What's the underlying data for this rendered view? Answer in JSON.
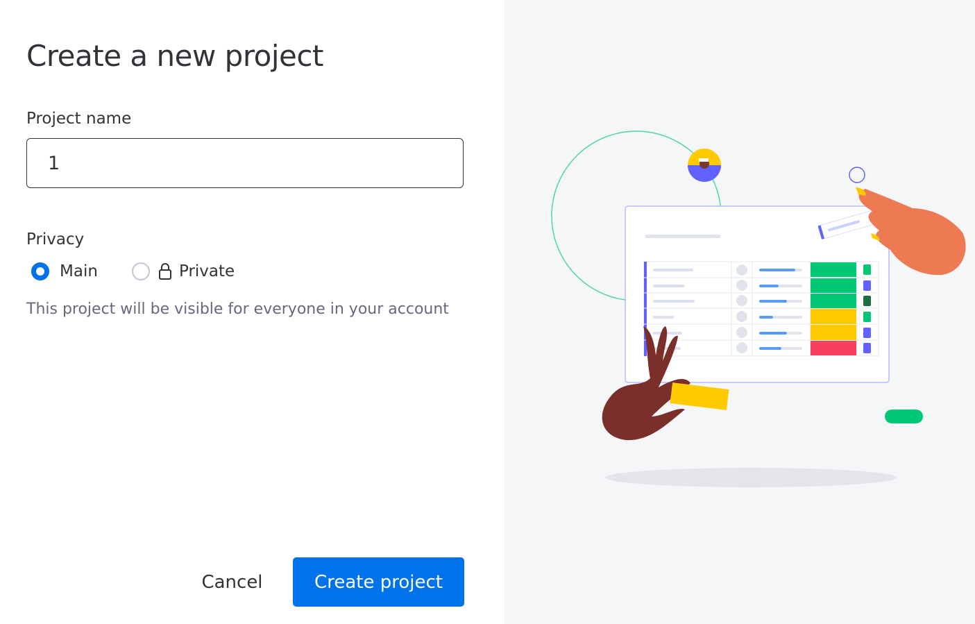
{
  "dialog": {
    "title": "Create a new project",
    "project_name_label": "Project name",
    "project_name_value": "1",
    "privacy_label": "Privacy",
    "privacy_options": [
      {
        "label": "Main",
        "selected": true
      },
      {
        "label": "Private",
        "selected": false,
        "icon": "lock-icon"
      }
    ],
    "privacy_description": "This project will be visible for everyone in your account",
    "cancel_label": "Cancel",
    "create_label": "Create project"
  },
  "colors": {
    "accent": "#0073ea",
    "text": "#323338",
    "secondary_text": "#676879",
    "panel_bg": "#f5f6f8",
    "status_green": "#00c875",
    "status_yellow": "#ffcb00",
    "status_red": "#f83f5e"
  }
}
